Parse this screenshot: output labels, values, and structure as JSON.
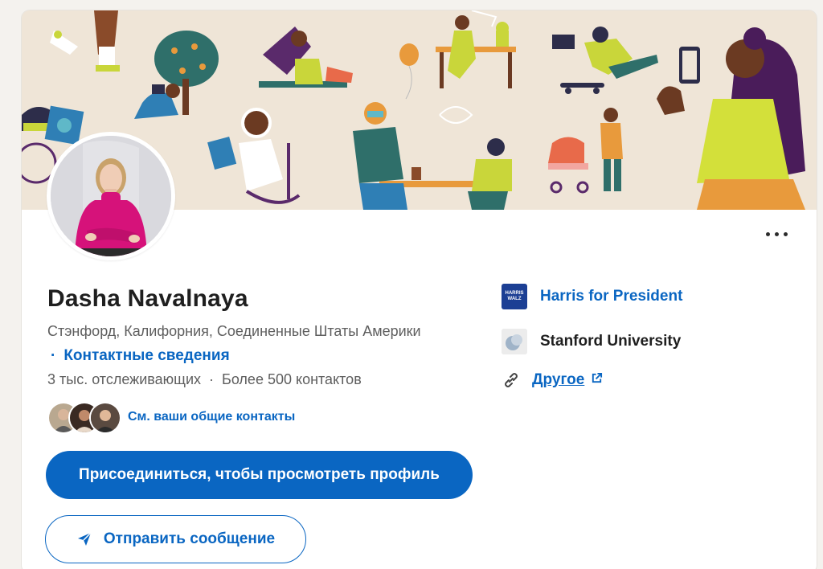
{
  "profile": {
    "name": "Dasha Navalnaya",
    "location": "Стэнфорд, Калифорния, Соединенные Штаты Америки",
    "contact_bullet": "·",
    "contact_info_link": "Контактные сведения",
    "followers": "3 тыс. отслеживающих",
    "stats_separator": "·",
    "connections": "Более 500 контактов",
    "mutual_link": "См. ваши общие контакты"
  },
  "actions": {
    "join_label": "Присоединиться, чтобы просмотреть профиль",
    "message_label": "Отправить сообщение",
    "more_icon": "ellipsis-icon"
  },
  "sidebar": {
    "items": [
      {
        "label": "Harris for President",
        "logo_text_top": "HARRIS",
        "logo_text_bottom": "WALZ",
        "icon": "harris-walz-logo"
      },
      {
        "label": "Stanford University",
        "icon": "stanford-logo"
      },
      {
        "label": "Другое",
        "icon": "link-icon",
        "trailing_icon": "external-link-icon"
      }
    ]
  },
  "colors": {
    "brand_blue": "#0a66c2",
    "banner_bg": "#efe5d7",
    "sweater_pink": "#d6127a"
  }
}
